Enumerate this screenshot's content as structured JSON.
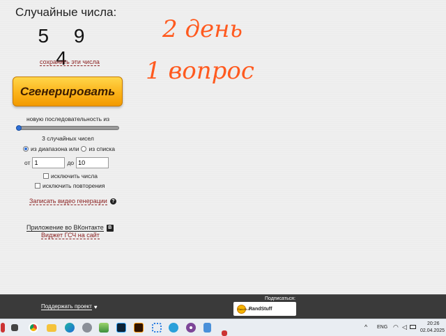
{
  "generator": {
    "title": "Случайные числа:",
    "numbers": [
      "5",
      "9",
      "4"
    ],
    "save_link": "сохранить эти числа",
    "generate_button": "Сгенерировать",
    "sequence_label": "новую последовательность из",
    "sequence_slider_value": 3,
    "count_label": "3 случайных чисел",
    "range_option": "из диапазона или",
    "list_option": "из списка",
    "selected_source": "range",
    "from_label": "от",
    "from_value": "1",
    "to_label": "до",
    "to_value": "10",
    "exclude_numbers": "исключить числа",
    "exclude_numbers_checked": false,
    "exclude_repeats": "исключить повторения",
    "exclude_repeats_checked": false,
    "record_video_link": "Записать видео генерации",
    "help_glyph": "?",
    "vk_app_link": "Приложение во ВКонтакте",
    "vk_glyph": "В",
    "widget_link": "Виджет ГСЧ на сайт"
  },
  "annotation": {
    "line1": "2 день",
    "line2": "1 вопрос",
    "color": "#ff5a1f"
  },
  "footer": {
    "support_link": "Поддержать проект",
    "subscribe_label": "Подписаться:",
    "channel_name": "RandStuff",
    "channel_logo_text": "RandStuff"
  },
  "taskbar": {
    "language": "ENG",
    "time": "20:26",
    "date": "02.04.2025",
    "apps": [
      "file-explorer-icon",
      "chrome-icon",
      "folder-icon",
      "edge-icon",
      "settings-icon",
      "photos-icon",
      "photoshop-icon",
      "illustrator-icon",
      "network-icon",
      "telegram-icon",
      "tor-icon",
      "notepad-icon"
    ]
  },
  "colors": {
    "button_orange": "#fbb31a",
    "link_red": "#8a1f1f",
    "footer_bg": "#3a3a3a",
    "accent_blue": "#2f6fd6"
  }
}
